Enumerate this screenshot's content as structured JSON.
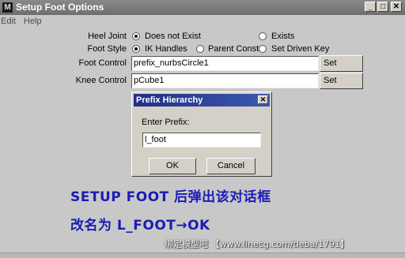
{
  "window": {
    "title": "Setup Foot Options",
    "app_icon": "maya-icon",
    "minimize_glyph": "_",
    "maximize_glyph": "□",
    "close_glyph": "✕"
  },
  "menu": {
    "items": [
      "Edit",
      "Help"
    ]
  },
  "form": {
    "heel_joint": {
      "label": "Heel Joint",
      "options": [
        "Does not Exist",
        "Exists"
      ],
      "selected": "Does not Exist"
    },
    "foot_style": {
      "label": "Foot Style",
      "options": [
        "IK Handles",
        "Parent Const",
        "Set Driven Key"
      ],
      "selected": "IK Handles"
    },
    "foot_control": {
      "label": "Foot Control",
      "value": "prefix_nurbsCircle1",
      "button": "Set"
    },
    "knee_control": {
      "label": "Knee Control",
      "value": "pCube1",
      "button": "Set"
    }
  },
  "dialog": {
    "title": "Prefix Hierarchy",
    "close_glyph": "✕",
    "prompt": "Enter Prefix:",
    "value": "l_foot",
    "ok": "OK",
    "cancel": "Cancel"
  },
  "annotation": {
    "line1": "SETUP FOOT 后弹出该对话框",
    "line2": "改名为 L_FOOT→OK",
    "color": "#1c1cb4"
  },
  "watermark": "绑定模型吧 【www.linecg.com/tieba/1791】"
}
